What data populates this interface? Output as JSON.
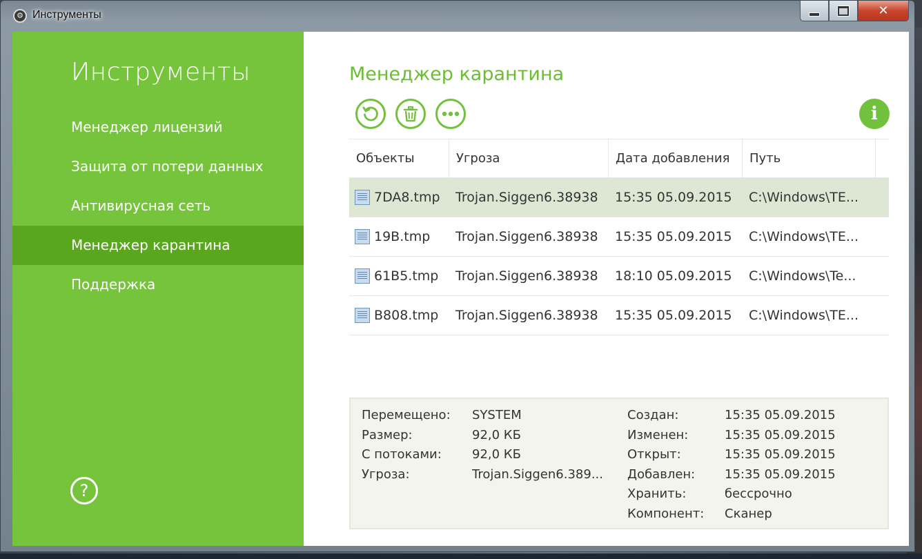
{
  "window": {
    "title": "Инструменты",
    "close_glyph": "✕",
    "app_icon": "gear-icon"
  },
  "sidebar": {
    "title": "Инструменты",
    "items": [
      {
        "label": "Менеджер лицензий"
      },
      {
        "label": "Защита от потери данных"
      },
      {
        "label": "Антивирусная сеть"
      },
      {
        "label": "Менеджер карантина",
        "active": true
      },
      {
        "label": "Поддержка"
      }
    ],
    "help_glyph": "?",
    "accent": "#76c43b",
    "active_color": "#5aa71f"
  },
  "main": {
    "title": "Менеджер карантина",
    "toolbar": {
      "restore_icon": "restore-icon",
      "delete_icon": "trash-icon",
      "more_icon": "more-icon",
      "info_glyph": "i"
    }
  },
  "table": {
    "columns": [
      "Объекты",
      "Угроза",
      "Дата добавления",
      "Путь"
    ],
    "rows": [
      {
        "object": "7DA8.tmp",
        "threat": "Trojan.Siggen6.38938",
        "date": "15:35 05.09.2015",
        "path": "C:\\Windows\\TE...",
        "selected": true
      },
      {
        "object": "19B.tmp",
        "threat": "Trojan.Siggen6.38938",
        "date": "15:35 05.09.2015",
        "path": "C:\\Windows\\TE..."
      },
      {
        "object": "61B5.tmp",
        "threat": "Trojan.Siggen6.38938",
        "date": "18:10 05.09.2015",
        "path": "C:\\Windows\\Te..."
      },
      {
        "object": "B808.tmp",
        "threat": "Trojan.Siggen6.38938",
        "date": "15:35 05.09.2015",
        "path": "C:\\Windows\\TE..."
      }
    ]
  },
  "details": {
    "left": [
      {
        "label": "Перемещено:",
        "value": "SYSTEM"
      },
      {
        "label": "Размер:",
        "value": "92,0 КБ"
      },
      {
        "label": "С потоками:",
        "value": "92,0 КБ"
      },
      {
        "label": "Угроза:",
        "value": "Trojan.Siggen6.389..."
      }
    ],
    "right": [
      {
        "label": "Создан:",
        "value": "15:35 05.09.2015"
      },
      {
        "label": "Изменен:",
        "value": "15:35 05.09.2015"
      },
      {
        "label": "Открыт:",
        "value": "15:35 05.09.2015"
      },
      {
        "label": "Добавлен:",
        "value": "15:35 05.09.2015"
      },
      {
        "label": "Хранить:",
        "value": "бессрочно"
      },
      {
        "label": "Компонент:",
        "value": "Сканер"
      }
    ]
  }
}
